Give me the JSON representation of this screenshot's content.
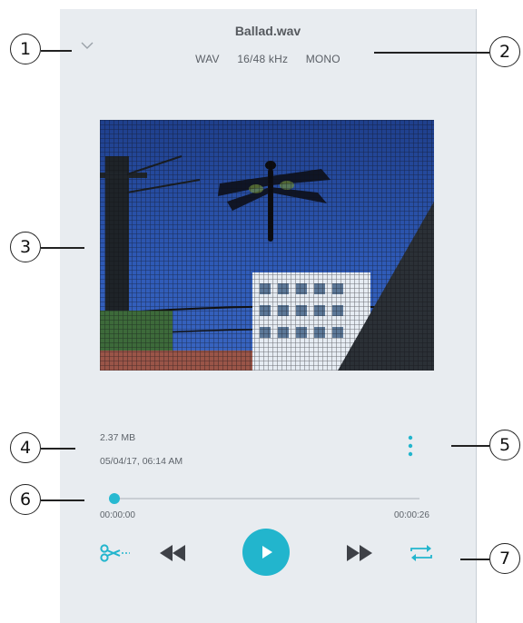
{
  "header": {
    "title": "Ballad.wav",
    "format": "WAV",
    "quality": "16/48 kHz",
    "channels": "MONO"
  },
  "file_info": {
    "size": "2.37 MB",
    "date": "05/04/17, 06:14 AM"
  },
  "playback": {
    "elapsed": "00:00:00",
    "duration": "00:00:26",
    "progress": 0
  },
  "callouts": [
    "1",
    "2",
    "3",
    "4",
    "5",
    "6",
    "7"
  ],
  "colors": {
    "accent": "#22b5cd",
    "panel_bg": "#e8ecf0",
    "text": "#55595e"
  },
  "icons": {
    "collapse": "chevron-down-icon",
    "more": "more-vertical-icon",
    "trim": "scissors-icon",
    "rewind": "rewind-icon",
    "play": "play-icon",
    "forward": "fast-forward-icon",
    "repeat": "repeat-icon"
  }
}
